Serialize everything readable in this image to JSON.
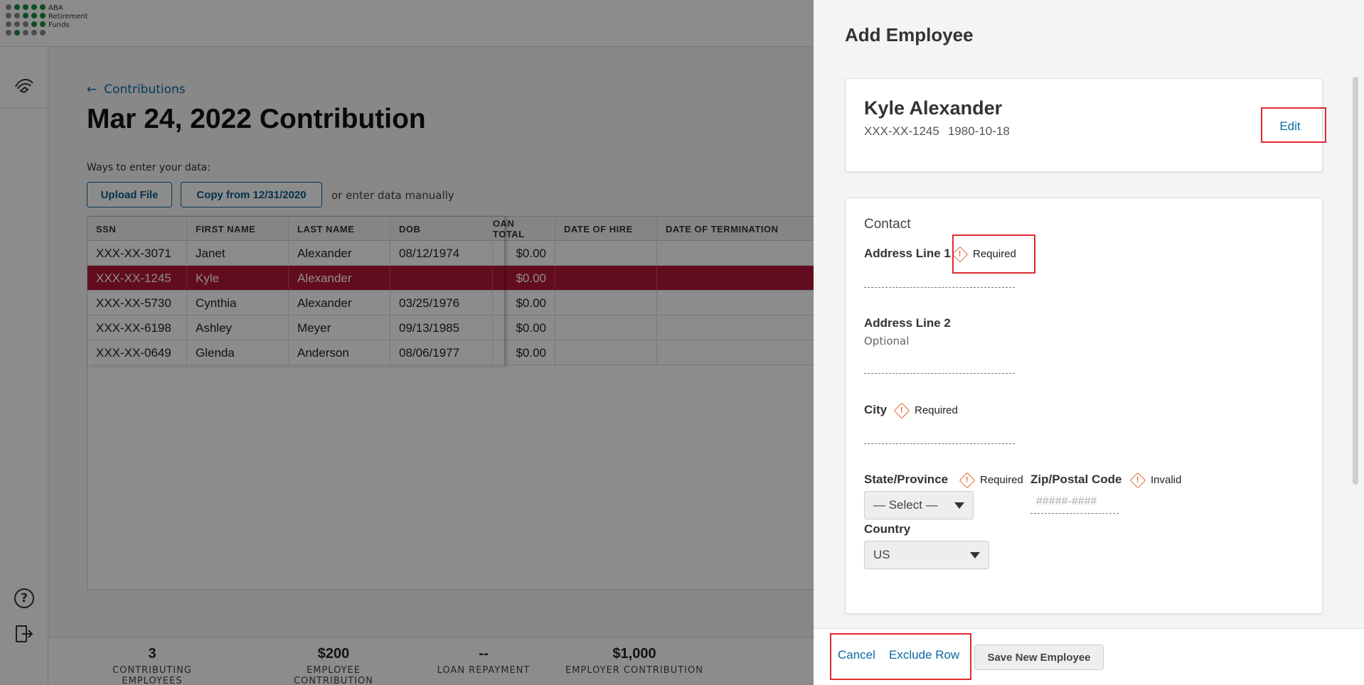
{
  "brand": {
    "line1": "ABA",
    "line2": "Retirement",
    "line3": "Funds"
  },
  "nav": {
    "active_icon": "handshake-icon",
    "help_icon": "help-icon",
    "logout_icon": "logout-icon"
  },
  "page": {
    "back_label": "Contributions",
    "title": "Mar 24, 2022 Contribution",
    "ways_label": "Ways to enter your data:",
    "upload_label": "Upload File",
    "copy_label": "Copy from 12/31/2020",
    "manual_label": "or enter data manually"
  },
  "grid": {
    "columns": [
      "SSN",
      "FIRST NAME",
      "LAST NAME",
      "DOB",
      "OAN TOTAL",
      "DATE OF HIRE",
      "DATE OF TERMINATION"
    ],
    "rows": [
      {
        "ssn": "XXX-XX-3071",
        "first": "Janet",
        "last": "Alexander",
        "dob": "08/12/1974",
        "loan": "$0.00"
      },
      {
        "ssn": "XXX-XX-1245",
        "first": "Kyle",
        "last": "Alexander",
        "dob": "",
        "loan": "$0.00"
      },
      {
        "ssn": "XXX-XX-5730",
        "first": "Cynthia",
        "last": "Alexander",
        "dob": "03/25/1976",
        "loan": "$0.00"
      },
      {
        "ssn": "XXX-XX-6198",
        "first": "Ashley",
        "last": "Meyer",
        "dob": "09/13/1985",
        "loan": "$0.00"
      },
      {
        "ssn": "XXX-XX-0649",
        "first": "Glenda",
        "last": "Anderson",
        "dob": "08/06/1977",
        "loan": "$0.00"
      }
    ]
  },
  "footer": {
    "stats": [
      {
        "value": "3",
        "label": "CONTRIBUTING EMPLOYEES"
      },
      {
        "value": "$200",
        "label": "EMPLOYEE CONTRIBUTION"
      },
      {
        "value": "--",
        "label": "LOAN REPAYMENT"
      },
      {
        "value": "$1,000",
        "label": "EMPLOYER CONTRIBUTION"
      }
    ]
  },
  "drawer": {
    "title": "Add Employee",
    "employee": {
      "name": "Kyle Alexander",
      "ssn": "XXX-XX-1245",
      "dob": "1980-10-18",
      "edit_label": "Edit"
    },
    "contact": {
      "section_title": "Contact",
      "address1": {
        "label": "Address Line 1",
        "status": "Required"
      },
      "address2": {
        "label": "Address Line 2",
        "hint": "Optional"
      },
      "city": {
        "label": "City",
        "status": "Required"
      },
      "state": {
        "label": "State/Province",
        "status": "Required",
        "value": "— Select —"
      },
      "zip": {
        "label": "Zip/Postal Code",
        "status": "Invalid",
        "placeholder": "#####-####"
      },
      "country": {
        "label": "Country",
        "value": "US"
      }
    },
    "actions": {
      "cancel": "Cancel",
      "exclude": "Exclude Row",
      "save": "Save New Employee"
    }
  },
  "colors": {
    "accent": "#0a6aa1",
    "selected_row": "#b3193a",
    "warning": "#e8622a",
    "highlight": "#e0292f"
  }
}
